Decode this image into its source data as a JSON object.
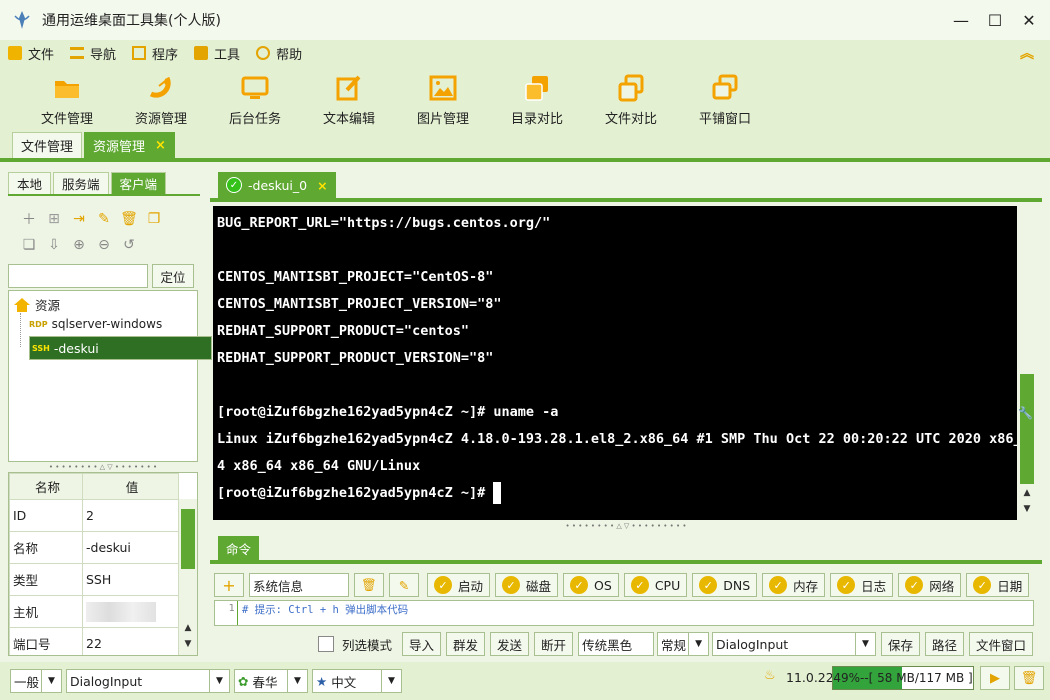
{
  "window": {
    "title": "通用运维桌面工具集(个人版)"
  },
  "menu": [
    {
      "label": "文件",
      "icon": "file-icon"
    },
    {
      "label": "导航",
      "icon": "list-icon"
    },
    {
      "label": "程序",
      "icon": "code-icon"
    },
    {
      "label": "工具",
      "icon": "toolbox-icon"
    },
    {
      "label": "帮助",
      "icon": "help-icon"
    }
  ],
  "toolbar": [
    {
      "label": "文件管理",
      "icon": "folder-icon"
    },
    {
      "label": "资源管理",
      "icon": "satellite-icon"
    },
    {
      "label": "后台任务",
      "icon": "monitor-icon"
    },
    {
      "label": "文本编辑",
      "icon": "edit-icon"
    },
    {
      "label": "图片管理",
      "icon": "image-icon"
    },
    {
      "label": "目录对比",
      "icon": "compare-dir-icon"
    },
    {
      "label": "文件对比",
      "icon": "compare-file-icon"
    },
    {
      "label": "平铺窗口",
      "icon": "tile-window-icon"
    }
  ],
  "main_tabs": [
    {
      "label": "文件管理"
    },
    {
      "label": "资源管理",
      "close": "×"
    }
  ],
  "left": {
    "sub_tabs": [
      "本地",
      "服务端",
      "客户端"
    ],
    "locate_label": "定位",
    "tree": {
      "root": "资源",
      "nodes": [
        {
          "tag": "RDP",
          "label": "sqlserver-windows"
        },
        {
          "tag": "SSH",
          "label": "-deskui"
        }
      ]
    },
    "props": {
      "headers": [
        "名称",
        "值"
      ],
      "rows": [
        {
          "k": "ID",
          "v": "2"
        },
        {
          "k": "名称",
          "v": "-deskui"
        },
        {
          "k": "类型",
          "v": "SSH"
        },
        {
          "k": "主机",
          "v": ""
        },
        {
          "k": "端口号",
          "v": "22"
        }
      ]
    }
  },
  "terminal": {
    "tab_label": "-deskui_0",
    "tab_close": "×",
    "lines": [
      "BUG_REPORT_URL=\"https://bugs.centos.org/\"",
      "",
      "CENTOS_MANTISBT_PROJECT=\"CentOS-8\"",
      "CENTOS_MANTISBT_PROJECT_VERSION=\"8\"",
      "REDHAT_SUPPORT_PRODUCT=\"centos\"",
      "REDHAT_SUPPORT_PRODUCT_VERSION=\"8\"",
      "",
      "[root@iZuf6bgzhe162yad5ypn4cZ ~]# uname -a",
      "Linux iZuf6bgzhe162yad5ypn4cZ 4.18.0-193.28.1.el8_2.x86_64 #1 SMP Thu Oct 22 00:20:22 UTC 2020 x86_6",
      "4 x86_64 x86_64 GNU/Linux",
      "[root@iZuf6bgzhe162yad5ypn4cZ ~]# "
    ]
  },
  "command": {
    "tab_label": "命令",
    "add_symbol": "+",
    "category_value": "系统信息",
    "quick_buttons": [
      "启动",
      "磁盘",
      "OS",
      "CPU",
      "DNS",
      "内存",
      "日志",
      "网络",
      "日期"
    ],
    "editor_line_no": "1",
    "editor_hint": "# 提示: Ctrl + h 弹出脚本代码",
    "bottom": {
      "column_mode": "列选模式",
      "import": "导入",
      "broadcast": "群发",
      "send": "发送",
      "disconnect": "断开",
      "theme": "传统黑色",
      "mode": "常规",
      "font": "DialogInput",
      "save": "保存",
      "path": "路径",
      "file_window": "文件窗口"
    }
  },
  "status": {
    "general": "一般",
    "font": "DialogInput",
    "season": "春华",
    "lang": "中文",
    "version": "11.0.22",
    "memory": "49%--[ 58 MB/117 MB ]",
    "memory_fraction": 0.49
  },
  "colors": {
    "accent": "#5fa832",
    "warning": "#e8b800"
  }
}
